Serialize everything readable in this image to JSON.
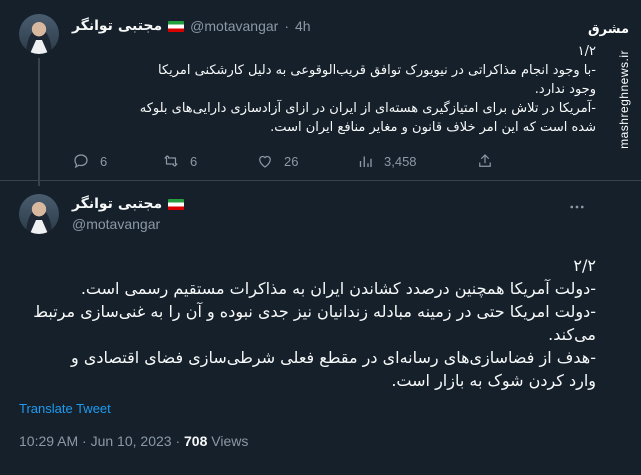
{
  "tweet1": {
    "author_name": "مجتبی توانگر",
    "handle": "@motavangar",
    "separator": "·",
    "time_ago": "4h",
    "counter": "۱/۲",
    "lines": [
      "-با وجود انجام مذاکراتی در نیویورک توافق قریب‌الوقوعی به دلیل کارشکنی امریکا",
      "وجود ندارد.",
      "-آمریکا در تلاش برای امتیازگیری هسته‌ای از ایران در ازای آزادسازی دارایی‌های بلوکه",
      "شده است که این امر خلاف قانون و مغایر منافع ایران است."
    ],
    "actions": {
      "replies": "6",
      "retweets": "6",
      "likes": "26",
      "views": "3,458"
    }
  },
  "tweet2": {
    "author_name": "مجتبی توانگر",
    "handle": "@motavangar",
    "counter": "۲/۲",
    "lines": [
      "-دولت آمریکا همچنین درصدد کشاندن ایران به مذاکرات مستقیم رسمی است.",
      "-دولت امریکا حتی در زمینه مبادله زندانیان نیز جدی نبوده و آن را به غنی‌سازی مرتبط",
      "می‌کند.",
      "-هدف از فضاسازی‌های رسانه‌ای در مقطع فعلی شرطی‌سازی فضای اقتصادی و",
      "وارد کردن شوک به بازار است."
    ],
    "translate_label": "Translate Tweet",
    "timestamp": "10:29 AM · Jun 10, 2023 · ",
    "views_count": "708",
    "views_label": " Views"
  },
  "watermark": {
    "logo": "مشرق",
    "site": "mashreghnews.ir"
  },
  "colors": {
    "background": "#15202b",
    "text": "#f7f9f9",
    "muted": "#8b98a5",
    "link": "#1d9bf0",
    "divider": "#38444d"
  }
}
